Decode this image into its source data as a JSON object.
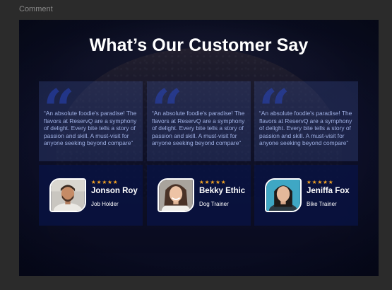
{
  "canvas": {
    "label": "Comment"
  },
  "section": {
    "title": "What’s Our Customer Say"
  },
  "testimonials": [
    {
      "quote": "“An absolute foodie's paradise! The flavors at ReservQ are a symphony of delight. Every bite tells a story of passion and skill. A must-visit for anyone seeking beyond compare”",
      "stars": "★★★★★",
      "name": "Jonson Roy",
      "role": "Job Holder"
    },
    {
      "quote": "“An absolute foodie's paradise! The flavors at ReservQ are a symphony of delight. Every bite tells a story of passion and skill. A must-visit for anyone seeking beyond compare”",
      "stars": "★★★★★",
      "name": "Bekky Ethic",
      "role": "Dog Trainer"
    },
    {
      "quote": "“An absolute foodie's paradise! The flavors at ReservQ are a symphony of delight. Every bite tells a story of passion and skill. A must-visit for anyone seeking beyond compare”",
      "stars": "★★★★★",
      "name": "Jeniffa Fox",
      "role": "Bike Trainer"
    }
  ],
  "colors": {
    "star": "#f4a424",
    "quote_text": "#9fb0e4",
    "card_bottom": "#08144a"
  }
}
